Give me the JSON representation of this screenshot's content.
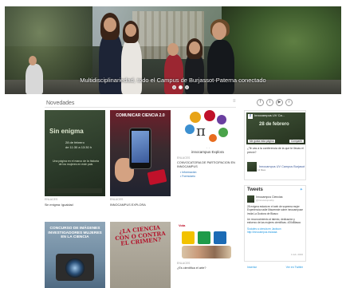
{
  "hero": {
    "caption": "Multidisciplinariedad, todo el Campus de Burjassot-Paterna conectado",
    "slides": 3,
    "active_slide": 2
  },
  "section": {
    "title": "Novedades"
  },
  "social_icons": [
    "facebook-icon",
    "twitter-icon",
    "youtube-icon",
    "rss-icon"
  ],
  "cards": [
    {
      "thumb": {
        "big": "Sin enigma",
        "date": "28 de febrero",
        "line2": "de 11:30 a 13:30 h",
        "small": "Una página en el marco de la historia de los mujeres en este pais"
      },
      "meta": "ENLACES",
      "title": "Sin enigma: Igualdad"
    },
    {
      "thumb": {
        "head": "COMUNICAR CIENCIA 2.0"
      },
      "meta": "ENLACES",
      "title": "INNOCAMPUS EXPLORA"
    },
    {
      "thumb": {
        "lbl": "apuntate",
        "lbl2": "innocampus Explora"
      },
      "meta": "ENLACES",
      "title": "CONVOCATORIA DE PARTICIPACION EN INNOCAMPUS",
      "bullets": [
        "Información",
        "Formulario"
      ]
    },
    {
      "thumb": {
        "head": "CONCURSO DE IMÁGENES INVESTIGADORES MUJERES EN LA CIENCIA"
      },
      "meta": "",
      "title": ""
    },
    {
      "thumb": {
        "head": "¿LA CIENCIA CON O CONTRA EL CRIMEN?"
      },
      "meta": "",
      "title": ""
    },
    {
      "thumb": {
        "tt": "Vota"
      },
      "meta": "ENLACES",
      "title": "¿Es científica el arte?"
    }
  ],
  "facebook_widget": {
    "page": "Innocampus UV Ca...",
    "date": "28 de febrero",
    "liked": "Me gusta esta página",
    "share": "Compartir",
    "text": "¿Te vas a la conferencia de la que te llevas el precio?",
    "profile_name": "Innocampus UV Campus Burjasot",
    "profile_small": "12 likes"
  },
  "tweets": {
    "title": "Tweets",
    "name": "Innocampus Ciencias",
    "handle": "@innocampusbp",
    "body": "28 enigma estará en el web de suprema mujer Experiencia nadie Maurenste sobre innocampuse invita La Doctora de Blasco",
    "body2": "Un reconocimiento al talento, dedicación y esfuerzo de las mujeres científicas. #20dBlasco",
    "body3": "Sociales a ciencia en Jackson http://innocampus.es/aaaa",
    "date": "1 feb. 2016",
    "embed": "Insertar",
    "view": "Ver en Twitter"
  },
  "colors": {
    "accent": "#c0112a",
    "facebook": "#3b5998",
    "twitter": "#55acee"
  }
}
